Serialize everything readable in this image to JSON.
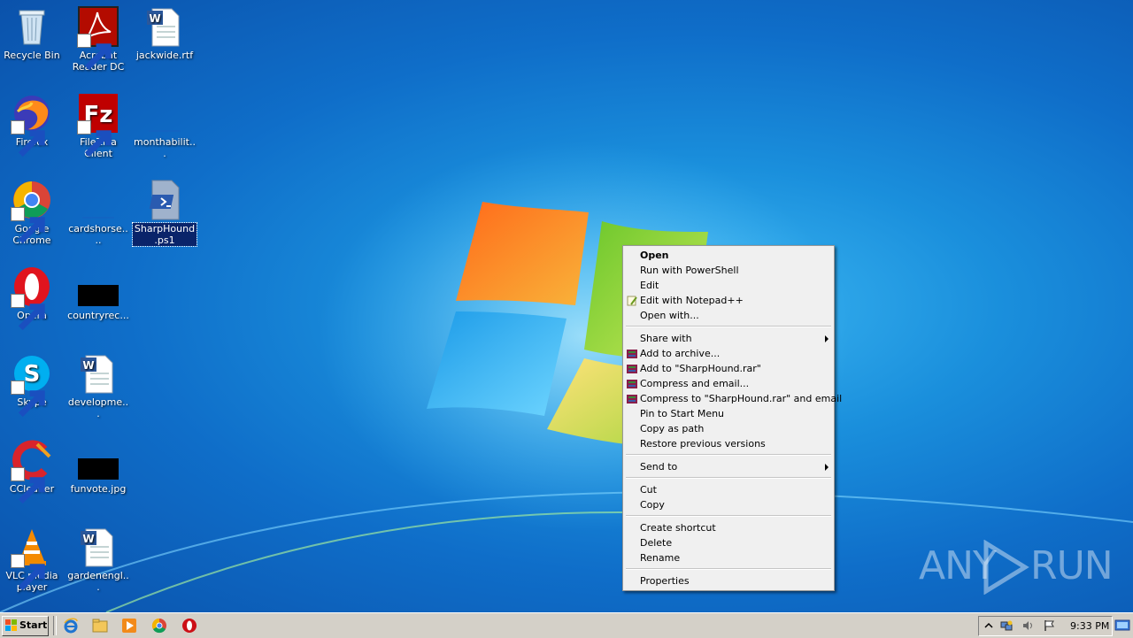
{
  "desktop": {
    "icons": [
      {
        "label": "Recycle Bin"
      },
      {
        "label": "Acrobat Reader DC"
      },
      {
        "label": "jackwide.rtf"
      },
      {
        "label": "Firefox"
      },
      {
        "label": "FileZilla Client"
      },
      {
        "label": "monthabilit..."
      },
      {
        "label": "Google Chrome"
      },
      {
        "label": "cardshorse...."
      },
      {
        "label": "SharpHound.ps1"
      },
      {
        "label": "Opera"
      },
      {
        "label": "countryrec..."
      },
      {
        "label": "Skype"
      },
      {
        "label": "developme..."
      },
      {
        "label": "CCleaner"
      },
      {
        "label": "funvote.jpg"
      },
      {
        "label": "VLC media player"
      },
      {
        "label": "gardenengl..."
      }
    ]
  },
  "context_menu": {
    "items": [
      {
        "label": "Open",
        "bold": true
      },
      {
        "label": "Run with PowerShell"
      },
      {
        "label": "Edit"
      },
      {
        "label": "Edit with Notepad++",
        "icon": "notepadpp-icon"
      },
      {
        "label": "Open with..."
      },
      {
        "label": "Share with",
        "submenu": true
      },
      {
        "label": "Add to archive...",
        "icon": "winrar-icon"
      },
      {
        "label": "Add to \"SharpHound.rar\"",
        "icon": "winrar-icon"
      },
      {
        "label": "Compress and email...",
        "icon": "winrar-icon"
      },
      {
        "label": "Compress to \"SharpHound.rar\" and email",
        "icon": "winrar-icon"
      },
      {
        "label": "Pin to Start Menu"
      },
      {
        "label": "Copy as path"
      },
      {
        "label": "Restore previous versions"
      },
      {
        "label": "Send to",
        "submenu": true
      },
      {
        "label": "Cut"
      },
      {
        "label": "Copy"
      },
      {
        "label": "Create shortcut"
      },
      {
        "label": "Delete"
      },
      {
        "label": "Rename"
      },
      {
        "label": "Properties"
      }
    ]
  },
  "taskbar": {
    "start_label": "Start",
    "quick_launch": [
      "internet-explorer-icon",
      "folder-icon",
      "media-player-icon",
      "chrome-icon",
      "opera-icon"
    ],
    "tray_icons": [
      "show-hidden-icon",
      "network-icon",
      "volume-icon",
      "action-center-flag-icon"
    ],
    "clock": "9:33 PM"
  },
  "watermark": {
    "left": "ANY",
    "right": "RUN"
  },
  "colors": {
    "menu_bg": "#f0f0f0",
    "selection": "#0a246a",
    "taskbar": "#d4d0c8"
  }
}
